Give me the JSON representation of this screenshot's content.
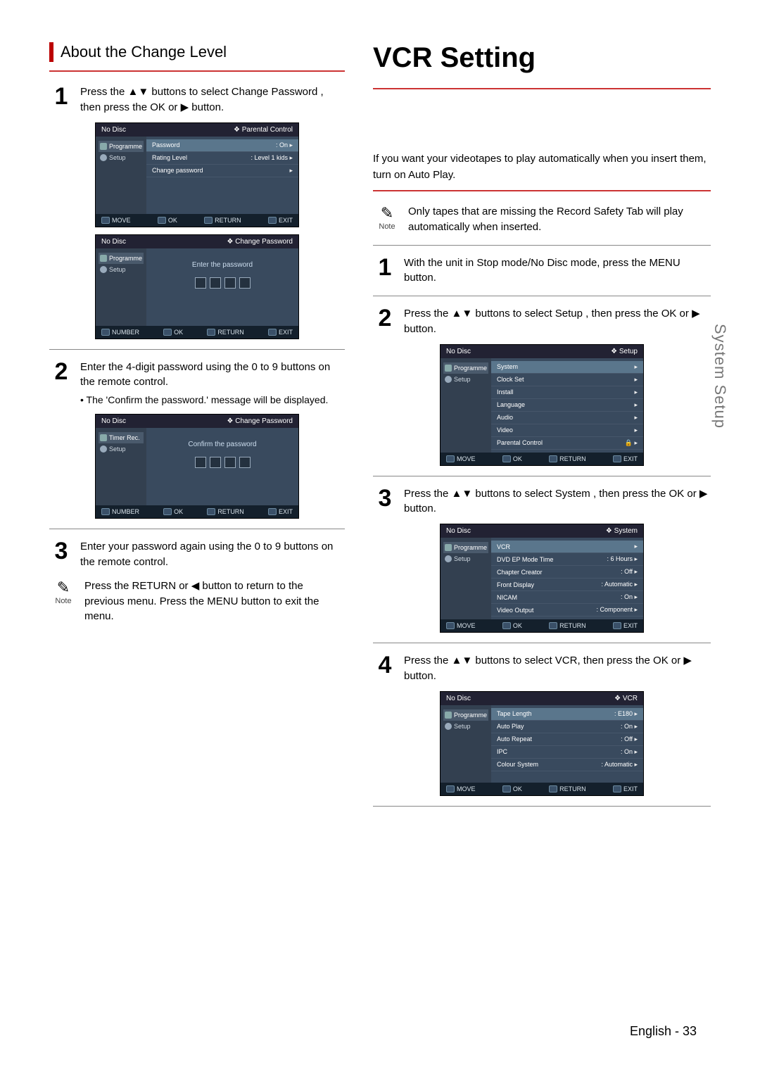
{
  "left": {
    "header": "About the Change Level",
    "step1": {
      "num": "1",
      "text": "Press the ▲▼ buttons to select Change Password , then press the OK or ▶ button."
    },
    "osd1": {
      "title_left": "No Disc",
      "title_right": "❖ Parental Control",
      "side": [
        {
          "label": "Programme",
          "active": true,
          "icon": "cam"
        },
        {
          "label": "Setup",
          "active": false,
          "icon": "gear"
        }
      ],
      "rows": [
        {
          "l": "Password",
          "r": ": On",
          "sel": true
        },
        {
          "l": "Rating Level",
          "r": ": Level 1 kids",
          "sel": false
        },
        {
          "l": "Change password",
          "r": "",
          "sel": false
        }
      ],
      "foot": {
        "a": "MOVE",
        "b": "OK",
        "c": "RETURN",
        "d": "EXIT"
      }
    },
    "osd2": {
      "title_left": "No Disc",
      "title_right": "❖ Change Password",
      "side": [
        {
          "label": "Programme",
          "active": true,
          "icon": "cam"
        },
        {
          "label": "Setup",
          "active": false,
          "icon": "gear"
        }
      ],
      "prompt": "Enter the password",
      "foot": {
        "a": "NUMBER",
        "b": "OK",
        "c": "RETURN",
        "d": "EXIT"
      }
    },
    "step2": {
      "num": "2",
      "text": "Enter the 4-digit password using the 0 to 9 buttons on the remote control.",
      "sub": "• The 'Confirm the password.' message will be displayed."
    },
    "osd3": {
      "title_left": "No Disc",
      "title_right": "❖ Change Password",
      "side": [
        {
          "label": "Timer Rec.",
          "active": true,
          "icon": "cam"
        },
        {
          "label": "Setup",
          "active": false,
          "icon": "gear"
        }
      ],
      "prompt": "Confirm the password",
      "foot": {
        "a": "NUMBER",
        "b": "OK",
        "c": "RETURN",
        "d": "EXIT"
      }
    },
    "step3": {
      "num": "3",
      "text": "Enter your password again using the 0 to 9 buttons on the remote control."
    },
    "note": {
      "label": "Note",
      "text": "Press the RETURN or ◀ button to return to the previous menu. Press the MENU button to exit the menu."
    }
  },
  "right": {
    "title": "VCR Setting",
    "intro": "If you want your videotapes to play automatically when you insert them, turn on Auto Play.",
    "note": {
      "label": "Note",
      "text": "Only tapes that are missing the Record Safety Tab will play automatically when inserted."
    },
    "step1": {
      "num": "1",
      "text": "With the unit in Stop mode/No Disc mode, press the MENU button."
    },
    "step2": {
      "num": "2",
      "text": "Press the ▲▼ buttons to select Setup , then press the OK or ▶ button."
    },
    "osd2": {
      "title_left": "No Disc",
      "title_right": "❖ Setup",
      "side": [
        {
          "label": "Programme",
          "active": true,
          "icon": "cam"
        },
        {
          "label": "Setup",
          "active": false,
          "icon": "gear"
        }
      ],
      "rows": [
        {
          "l": "System",
          "r": "",
          "sel": true
        },
        {
          "l": "Clock Set",
          "r": "",
          "sel": false
        },
        {
          "l": "Install",
          "r": "",
          "sel": false
        },
        {
          "l": "Language",
          "r": "",
          "sel": false
        },
        {
          "l": "Audio",
          "r": "",
          "sel": false
        },
        {
          "l": "Video",
          "r": "",
          "sel": false
        },
        {
          "l": "Parental Control",
          "r": "🔒",
          "sel": false
        }
      ],
      "foot": {
        "a": "MOVE",
        "b": "OK",
        "c": "RETURN",
        "d": "EXIT"
      }
    },
    "step3": {
      "num": "3",
      "text": "Press the ▲▼ buttons to select System , then press the OK or ▶ button."
    },
    "osd3": {
      "title_left": "No Disc",
      "title_right": "❖ System",
      "side": [
        {
          "label": "Programme",
          "active": true,
          "icon": "cam"
        },
        {
          "label": "Setup",
          "active": false,
          "icon": "gear"
        }
      ],
      "rows": [
        {
          "l": "VCR",
          "r": "",
          "sel": true
        },
        {
          "l": "DVD EP Mode Time",
          "r": ": 6 Hours",
          "sel": false
        },
        {
          "l": "Chapter Creator",
          "r": ": Off",
          "sel": false
        },
        {
          "l": "Front Display",
          "r": ": Automatic",
          "sel": false
        },
        {
          "l": "NICAM",
          "r": ": On",
          "sel": false
        },
        {
          "l": "Video Output",
          "r": ": Component",
          "sel": false
        }
      ],
      "foot": {
        "a": "MOVE",
        "b": "OK",
        "c": "RETURN",
        "d": "EXIT"
      }
    },
    "step4": {
      "num": "4",
      "text": "Press the ▲▼ buttons to select VCR, then press the OK or ▶ button."
    },
    "osd4": {
      "title_left": "No Disc",
      "title_right": "❖ VCR",
      "side": [
        {
          "label": "Programme",
          "active": true,
          "icon": "cam"
        },
        {
          "label": "Setup",
          "active": false,
          "icon": "gear"
        }
      ],
      "rows": [
        {
          "l": "Tape Length",
          "r": ": E180",
          "sel": true
        },
        {
          "l": "Auto Play",
          "r": ": On",
          "sel": false
        },
        {
          "l": "Auto Repeat",
          "r": ": Off",
          "sel": false
        },
        {
          "l": "IPC",
          "r": ": On",
          "sel": false
        },
        {
          "l": "Colour System",
          "r": ": Automatic",
          "sel": false
        }
      ],
      "foot": {
        "a": "MOVE",
        "b": "OK",
        "c": "RETURN",
        "d": "EXIT"
      }
    }
  },
  "vtab": "System Setup",
  "footer": "English - 33"
}
